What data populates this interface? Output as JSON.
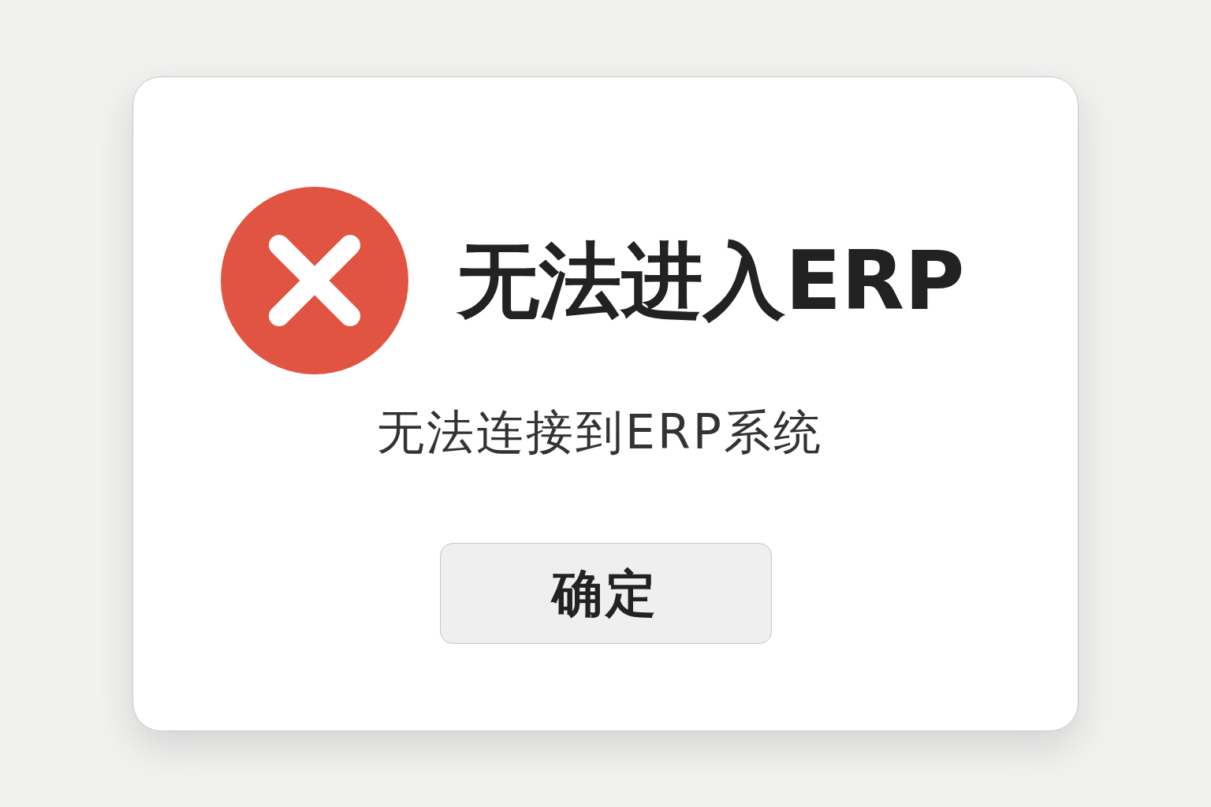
{
  "dialog": {
    "title": "无法进入ERP",
    "message": "无法连接到ERP系统",
    "buttons": [
      {
        "label": "确定"
      }
    ]
  }
}
